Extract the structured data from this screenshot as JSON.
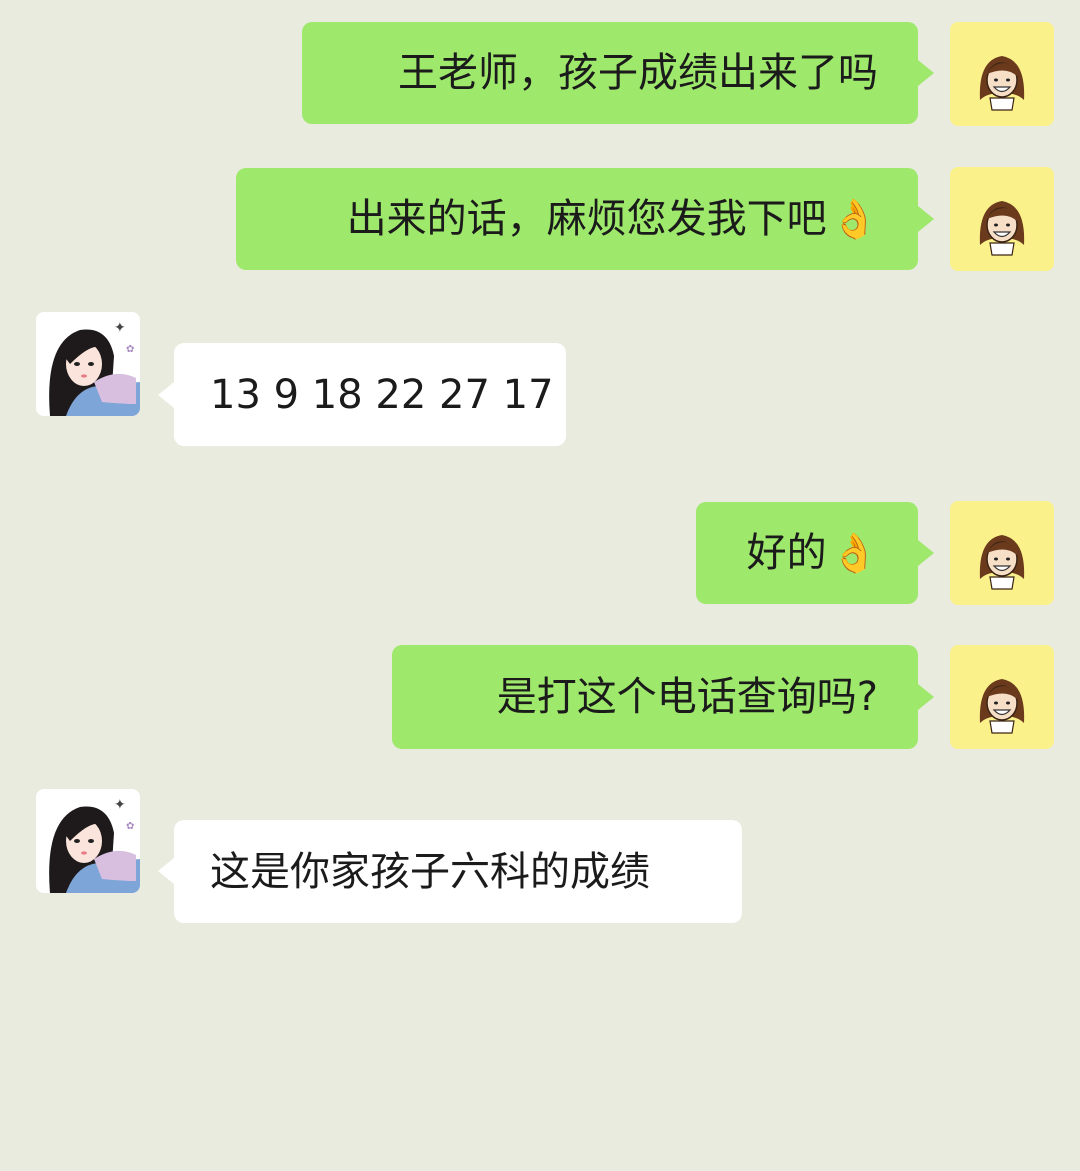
{
  "messages": [
    {
      "from": "me",
      "text": "王老师，孩子成绩出来了吗",
      "emoji": ""
    },
    {
      "from": "me",
      "text": "出来的话，麻烦您发我下吧",
      "emoji": "👌"
    },
    {
      "from": "teacher",
      "text": "13 9 18 22 27 17",
      "emoji": ""
    },
    {
      "from": "me",
      "text": "好的",
      "emoji": "👌"
    },
    {
      "from": "me",
      "text": "是打这个电话查询吗?",
      "emoji": ""
    },
    {
      "from": "teacher",
      "text": "这是你家孩子六科的成绩",
      "emoji": ""
    }
  ],
  "colors": {
    "background": "#e9ebdf",
    "outgoing_bubble": "#9ee86c",
    "incoming_bubble": "#ffffff",
    "my_avatar_bg": "#fbf18a"
  }
}
